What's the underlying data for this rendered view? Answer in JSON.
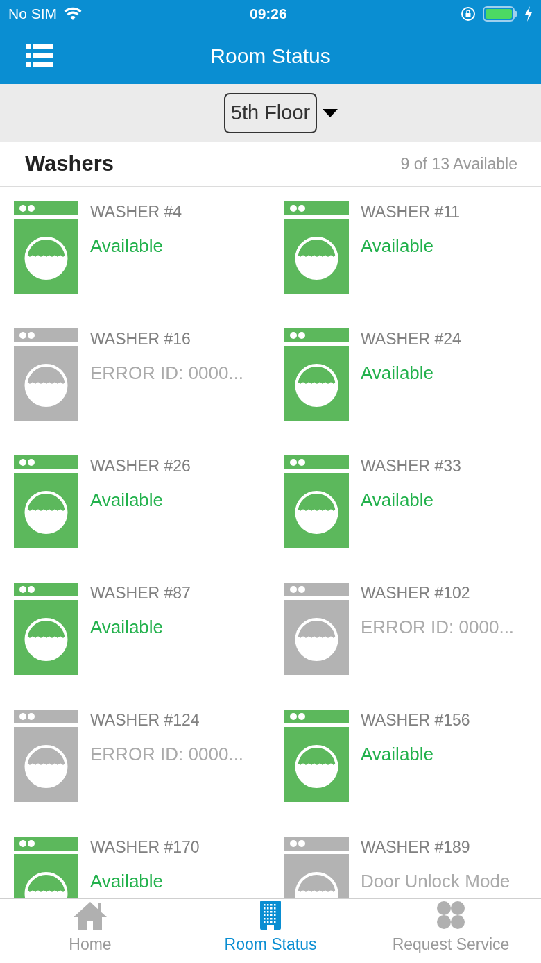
{
  "status_bar": {
    "carrier": "No SIM",
    "time": "09:26"
  },
  "nav_bar": {
    "title": "Room Status"
  },
  "floor_selector": {
    "value": "5th Floor"
  },
  "section": {
    "title": "Washers",
    "summary": "9 of 13 Available"
  },
  "machines": [
    {
      "name": "WASHER #4",
      "status": "Available",
      "available": true
    },
    {
      "name": "WASHER #11",
      "status": "Available",
      "available": true
    },
    {
      "name": "WASHER #16",
      "status": "ERROR ID: 0000...",
      "available": false
    },
    {
      "name": "WASHER #24",
      "status": "Available",
      "available": true
    },
    {
      "name": "WASHER #26",
      "status": "Available",
      "available": true
    },
    {
      "name": "WASHER #33",
      "status": "Available",
      "available": true
    },
    {
      "name": "WASHER #87",
      "status": "Available",
      "available": true
    },
    {
      "name": "WASHER #102",
      "status": "ERROR ID: 0000...",
      "available": false
    },
    {
      "name": "WASHER #124",
      "status": "ERROR ID: 0000...",
      "available": false
    },
    {
      "name": "WASHER #156",
      "status": "Available",
      "available": true
    },
    {
      "name": "WASHER #170",
      "status": "Available",
      "available": true
    },
    {
      "name": "WASHER #189",
      "status": "Door Unlock Mode",
      "available": false
    }
  ],
  "tab_bar": [
    {
      "label": "Home",
      "kind": "home",
      "selected": false
    },
    {
      "label": "Room Status",
      "kind": "building",
      "selected": true
    },
    {
      "label": "Request Service",
      "kind": "service",
      "selected": false
    }
  ]
}
